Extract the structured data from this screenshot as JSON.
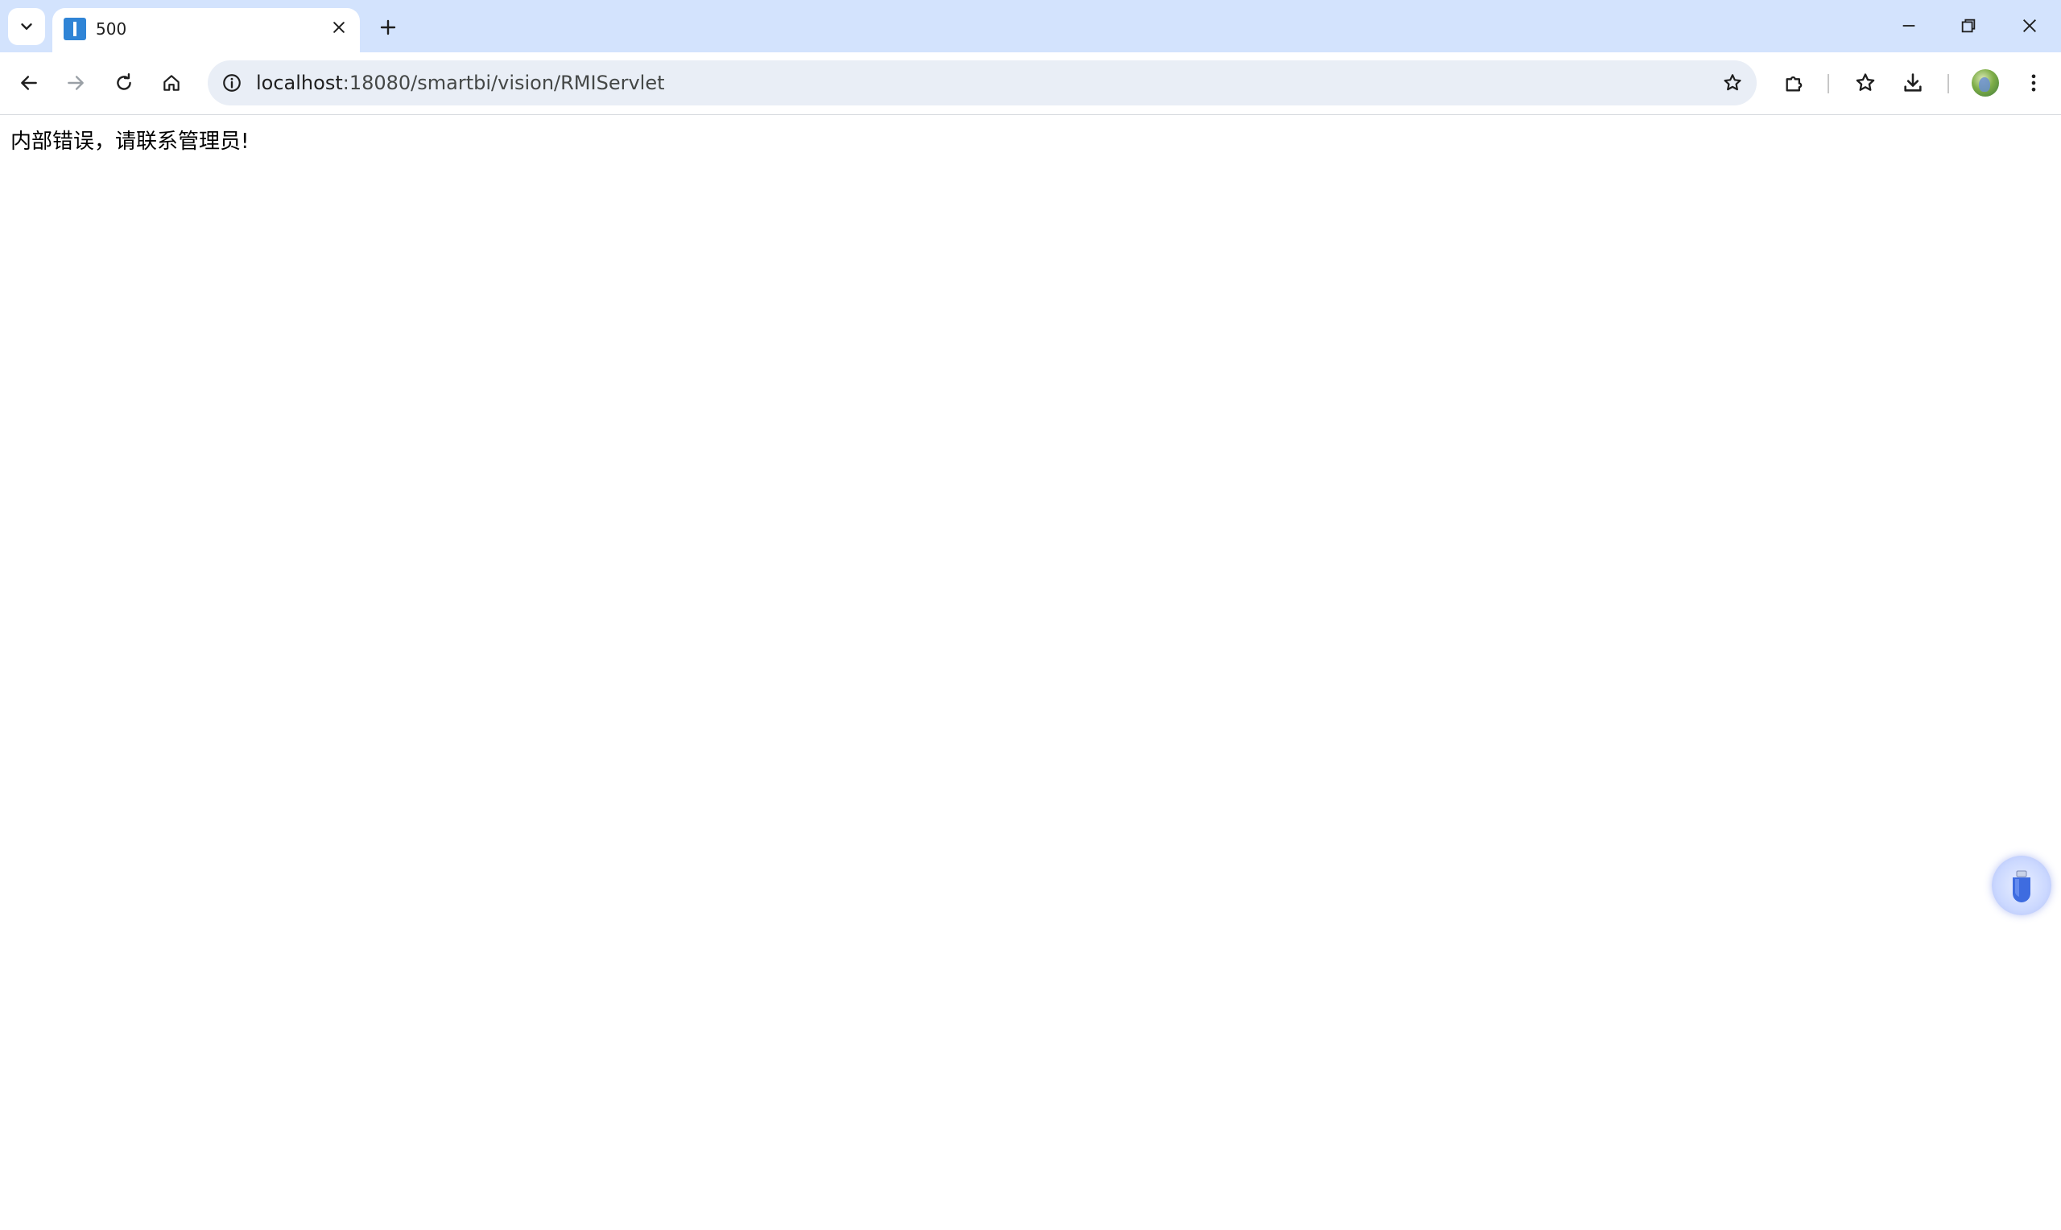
{
  "tab": {
    "title": "500"
  },
  "address_bar": {
    "host": "localhost",
    "path": ":18080/smartbi/vision/RMIServlet"
  },
  "page": {
    "message": "内部错误，请联系管理员!"
  },
  "colors": {
    "tabstrip_bg": "#d3e3fd",
    "omnibox_bg": "#e9eef6",
    "favicon": "#2f84d6"
  },
  "icons": {
    "tab_search": "chevron-down-icon",
    "tab_close": "close-icon",
    "new_tab": "plus-icon",
    "back": "arrow-left-icon",
    "forward": "arrow-right-icon",
    "reload": "reload-icon",
    "home": "home-icon",
    "site_info": "info-icon",
    "bookmark": "star-icon",
    "extensions": "puzzle-icon",
    "bookmarks": "star-list-icon",
    "downloads": "download-icon",
    "menu": "kebab-menu-icon"
  }
}
